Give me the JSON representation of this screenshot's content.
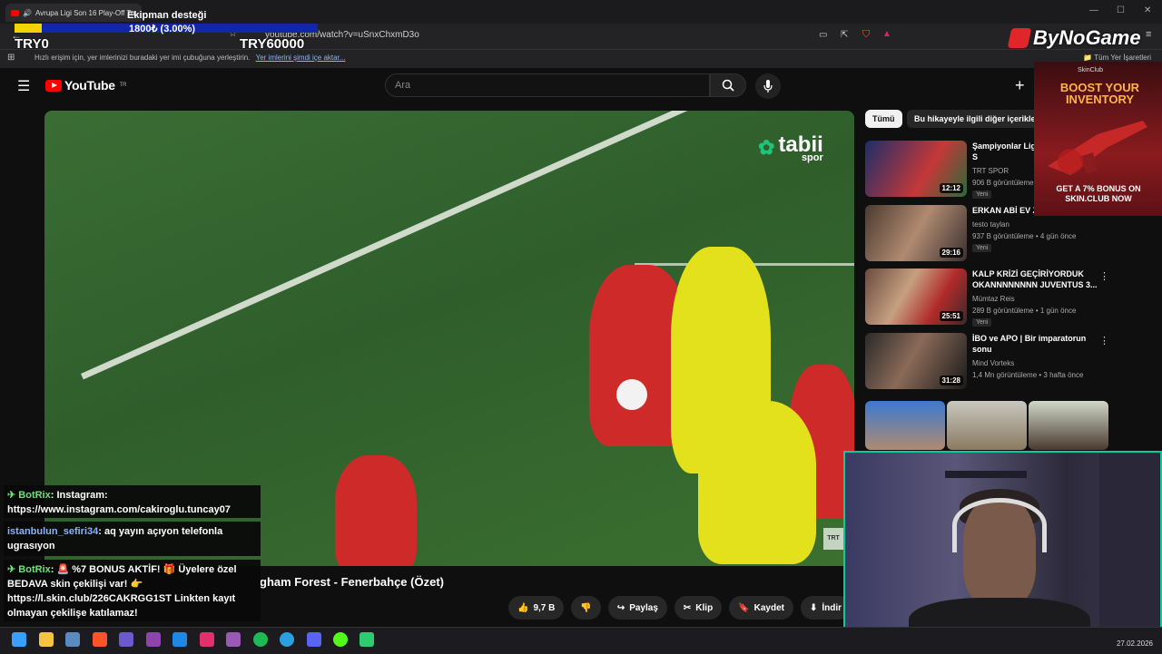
{
  "browser": {
    "tab_title": "Avrupa Ligi Son 16 Play-Off Tu",
    "url": "youtube.com/watch?v=uSnxChxmD3o",
    "bookmarks_hint": "Hızlı erişim için, yer imlerinizi buradaki yer imi çubuğuna yerleştirin.",
    "bookmarks_link": "Yer imlerini şimdi içe aktar...",
    "all_bookmarks": "Tüm Yer İşaretleri"
  },
  "youtube": {
    "logo_text": "YouTube",
    "logo_region": "TR",
    "search_placeholder": "Ara"
  },
  "video": {
    "title_visible": "gham Forest - Fenerbahçe (Özet)",
    "watermark": "tabii",
    "watermark_sub": "spor",
    "trt_badge": "TRT",
    "actions": {
      "likes": "9,7 B",
      "share": "Paylaş",
      "clip": "Klip",
      "save": "Kaydet",
      "download": "İndir"
    }
  },
  "sidebar": {
    "chips": [
      "Tümü",
      "Bu hikayeyle ilgili diğer içerikler"
    ],
    "items": [
      {
        "title": "Şampiyonlar Ligi Off Turu | Paris S",
        "channel": "TRT SPOR",
        "meta": "906 B görüntüleme",
        "badge": "Yeni",
        "duration": "12:12"
      },
      {
        "title": "ERKAN ABİ EV Z",
        "channel": "testo taylan",
        "meta": "937 B görüntüleme • 4 gün önce",
        "badge": "Yeni",
        "duration": "29:16"
      },
      {
        "title": "KALP KRİZİ GEÇİRİYORDUK OKANNNNNNNN JUVENTUS 3...",
        "channel": "Mümtaz Reis",
        "meta": "289 B görüntüleme • 1 gün önce",
        "badge": "Yeni",
        "duration": "25:51"
      },
      {
        "title": "İBO ve APO | Bir imparatorun sonu",
        "channel": "Mind Vorteks",
        "meta": "1,4 Mn görüntüleme • 3 hafta önce",
        "badge": "",
        "duration": "31:28"
      }
    ]
  },
  "ad": {
    "brand": "SkinClub",
    "headline": "BOOST YOUR INVENTORY",
    "bonus": "GET A 7% BONUS ON SKIN.CLUB NOW"
  },
  "stream_overlay": {
    "donation_title": "Ekipman desteği",
    "donation_progress_text": "1800₺ (3.00%)",
    "donation_progress": 0.03,
    "goal_start": "TRY0",
    "goal_end": "TRY60000",
    "sponsor": "ByNoGame",
    "chat": [
      {
        "user": "BotRix",
        "prefix": "✈ ",
        "text": "Instagram: https://www.instagram.com/cakiroglu.tuncay07"
      },
      {
        "user": "istanbulun_sefiri34",
        "prefix": "",
        "text": "aq yayın açıyon telefonla ugrasıyon"
      },
      {
        "user": "BotRix",
        "prefix": "✈ ",
        "text": "🚨 %7 BONUS AKTİF! 🎁 Üyelere özel BEDAVA skin çekilişi var! 👉 https://l.skin.club/226CAKRGG1ST Linkten kayıt olmayan çekilişe katılamaz!"
      }
    ]
  },
  "taskbar": {
    "date": "27.02.2026"
  },
  "colors": {
    "youtube_red": "#ff0000",
    "webcam_border": "#14c79a",
    "donation_bar": "#1226a8",
    "donation_fill": "#f5d300"
  }
}
